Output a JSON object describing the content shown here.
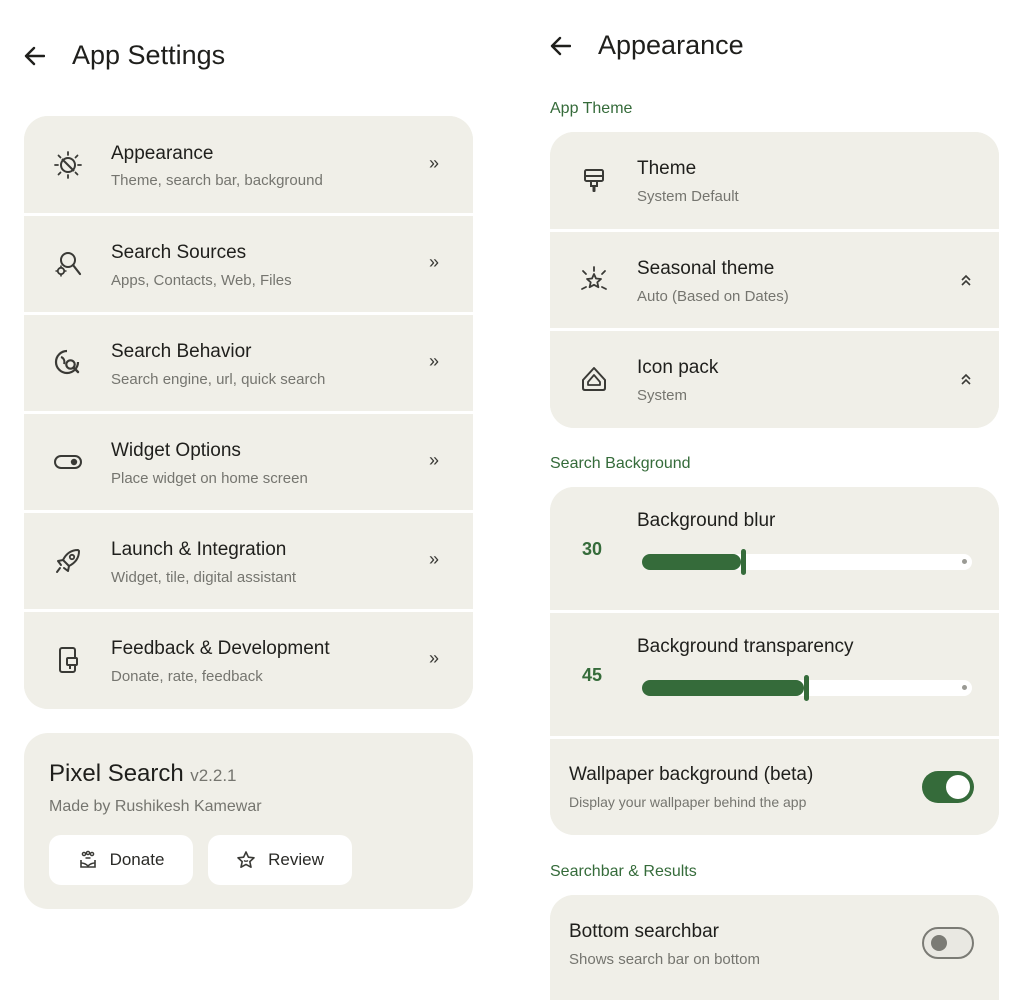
{
  "left": {
    "title": "App Settings",
    "menu": [
      {
        "title": "Appearance",
        "subtitle": "Theme, search bar, background",
        "icon": "brightness-icon",
        "chevron": "»"
      },
      {
        "title": "Search Sources",
        "subtitle": "Apps, Contacts, Web, Files",
        "icon": "manage-search-icon",
        "chevron": "»"
      },
      {
        "title": "Search Behavior",
        "subtitle": "Search engine, url, quick search",
        "icon": "travel-explore-icon",
        "chevron": "»"
      },
      {
        "title": "Widget Options",
        "subtitle": "Place widget on home screen",
        "icon": "toggle-icon",
        "chevron": "»"
      },
      {
        "title": "Launch & Integration",
        "subtitle": "Widget, tile, digital assistant",
        "icon": "rocket-icon",
        "chevron": "»"
      },
      {
        "title": "Feedback & Development",
        "subtitle": "Donate, rate, feedback",
        "icon": "feedback-icon",
        "chevron": "»"
      }
    ],
    "about": {
      "app_name": "Pixel Search",
      "version": "v2.2.1",
      "author": "Made by Rushikesh Kamewar",
      "donate_label": "Donate",
      "review_label": "Review"
    }
  },
  "right": {
    "title": "Appearance",
    "sections": {
      "app_theme": "App Theme",
      "search_background": "Search Background",
      "searchbar_results": "Searchbar & Results"
    },
    "theme_rows": [
      {
        "title": "Theme",
        "subtitle": "System Default",
        "icon": "format-paint-icon",
        "chevron": ""
      },
      {
        "title": "Seasonal theme",
        "subtitle": "Auto (Based on Dates)",
        "icon": "celebration-icon",
        "chevron": "⌃"
      },
      {
        "title": "Icon pack",
        "subtitle": "System",
        "icon": "icon-pack-icon",
        "chevron": "⌃"
      }
    ],
    "sliders": [
      {
        "title": "Background blur",
        "value": "30",
        "fraction": 0.3
      },
      {
        "title": "Background transparency",
        "value": "45",
        "fraction": 0.49
      }
    ],
    "wallpaper": {
      "title": "Wallpaper background (beta)",
      "subtitle": "Display your wallpaper behind the app",
      "enabled": true
    },
    "bottom_searchbar": {
      "title": "Bottom searchbar",
      "subtitle": "Shows search bar on bottom",
      "enabled": false
    }
  },
  "colors": {
    "accent": "#356b3a",
    "card": "#f0efe8",
    "background": "#ffffff"
  }
}
